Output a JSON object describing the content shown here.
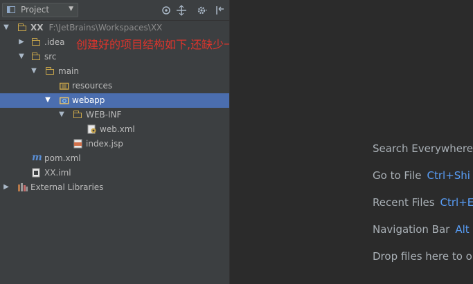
{
  "toolbar": {
    "view_label": "Project",
    "icons": [
      "locate-icon",
      "collapse-all-icon",
      "settings-icon",
      "hide-icon"
    ]
  },
  "tree": {
    "project_name": "XX",
    "project_path": "F:\\JetBrains\\Workspaces\\XX",
    "idea": ".idea",
    "src": "src",
    "main": "main",
    "resources": "resources",
    "webapp": "webapp",
    "webinf": "WEB-INF",
    "webxml": "web.xml",
    "indexjsp": "index.jsp",
    "pom": "pom.xml",
    "iml": "XX.iml",
    "extlib": "External Libraries"
  },
  "annotation": "创建好的项目结构如下,还缺少一些文件夹,我们手动创建",
  "editor_hints": [
    {
      "label": "Search Everywhere",
      "key": ""
    },
    {
      "label": "Go to File",
      "key": "Ctrl+Shi"
    },
    {
      "label": "Recent Files",
      "key": "Ctrl+E"
    },
    {
      "label": "Navigation Bar",
      "key": "Alt"
    },
    {
      "label": "Drop files here to o",
      "key": ""
    }
  ],
  "colors": {
    "selection": "#4b6eaf",
    "annotation": "#e0342c",
    "shortcut": "#589df6",
    "folder": "#c9a64b"
  }
}
